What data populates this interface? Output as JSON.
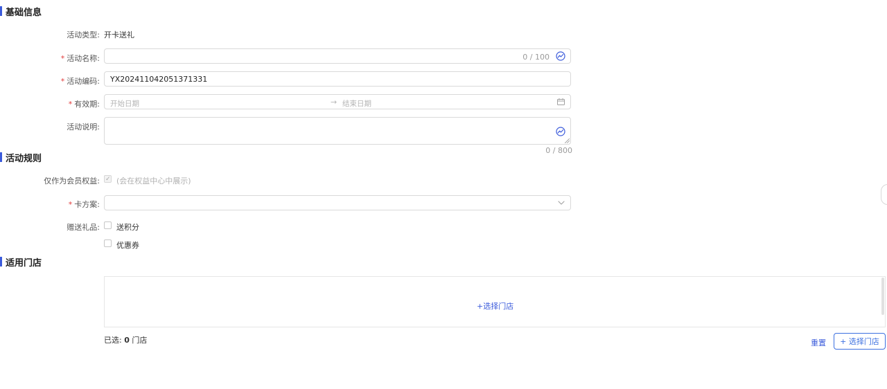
{
  "sections": {
    "basic": "基础信息",
    "rules": "活动规则",
    "stores": "适用门店"
  },
  "basic": {
    "activity_type": {
      "label": "活动类型:",
      "value": "开卡送礼"
    },
    "activity_name": {
      "required": "*",
      "label": "活动名称:",
      "value": "",
      "counter": "0 / 100"
    },
    "activity_code": {
      "required": "*",
      "label": "活动编码:",
      "value": "YX202411042051371331"
    },
    "validity": {
      "required": "*",
      "label": "有效期:",
      "start_placeholder": "开始日期",
      "arrow": "→",
      "end_placeholder": "结束日期"
    },
    "description": {
      "label": "活动说明:",
      "value": "",
      "counter": "0 / 800"
    }
  },
  "rules": {
    "member_benefit": {
      "label": "仅作为会员权益:",
      "checked": true,
      "hint": "(会在权益中心中展示)"
    },
    "card_plan": {
      "required": "*",
      "label": "卡方案:",
      "value": ""
    },
    "gifts": {
      "label": "赠送礼品:",
      "options": [
        "送积分",
        "优惠券"
      ]
    }
  },
  "stores": {
    "select_link": "+选择门店",
    "selected_prefix": "已选:",
    "selected_count": "0",
    "selected_suffix": "门店",
    "reset_label": "重置",
    "select_button": "+ 选择门店"
  },
  "colors": {
    "accent": "#3b5bdb",
    "required": "#e23c3c"
  },
  "icons": {
    "ai_assist": "ai-assist-icon",
    "calendar": "calendar-icon",
    "dropdown": "chevron-down-icon"
  }
}
